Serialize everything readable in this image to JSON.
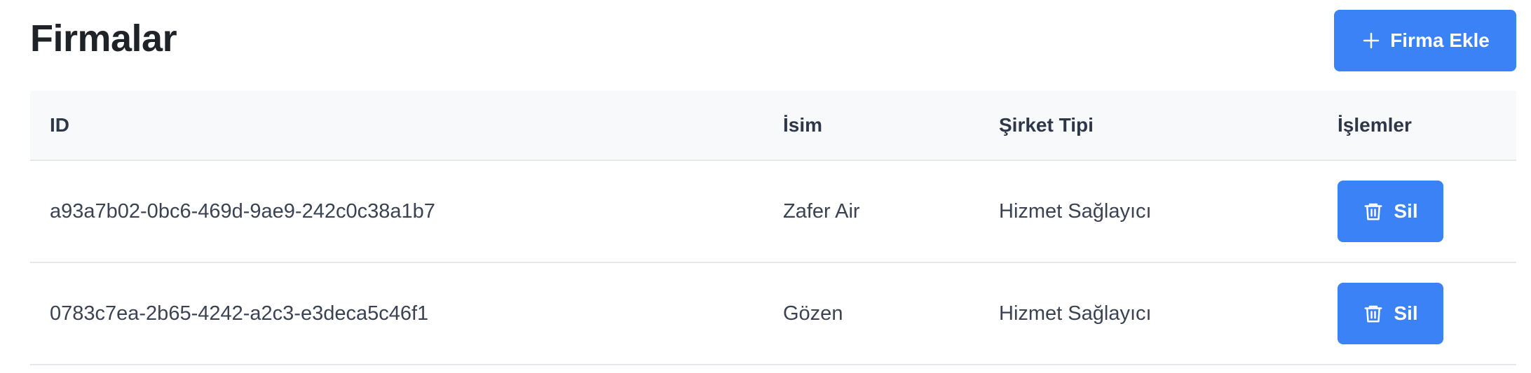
{
  "header": {
    "title": "Firmalar",
    "add_button_label": "Firma Ekle",
    "add_button_icon": "plus-icon"
  },
  "table": {
    "columns": [
      "ID",
      "İsim",
      "Şirket Tipi",
      "İşlemler"
    ],
    "rows": [
      {
        "id": "a93a7b02-0bc6-469d-9ae9-242c0c38a1b7",
        "name": "Zafer Air",
        "type": "Hizmet Sağlayıcı",
        "action_label": "Sil"
      },
      {
        "id": "0783c7ea-2b65-4242-a2c3-e3deca5c46f1",
        "name": "Gözen",
        "type": "Hizmet Sağlayıcı",
        "action_label": "Sil"
      }
    ],
    "action_icon": "trash-icon"
  },
  "colors": {
    "accent": "#3b82f6",
    "header_bg": "#f8f9fb",
    "border": "#e5e7eb"
  }
}
